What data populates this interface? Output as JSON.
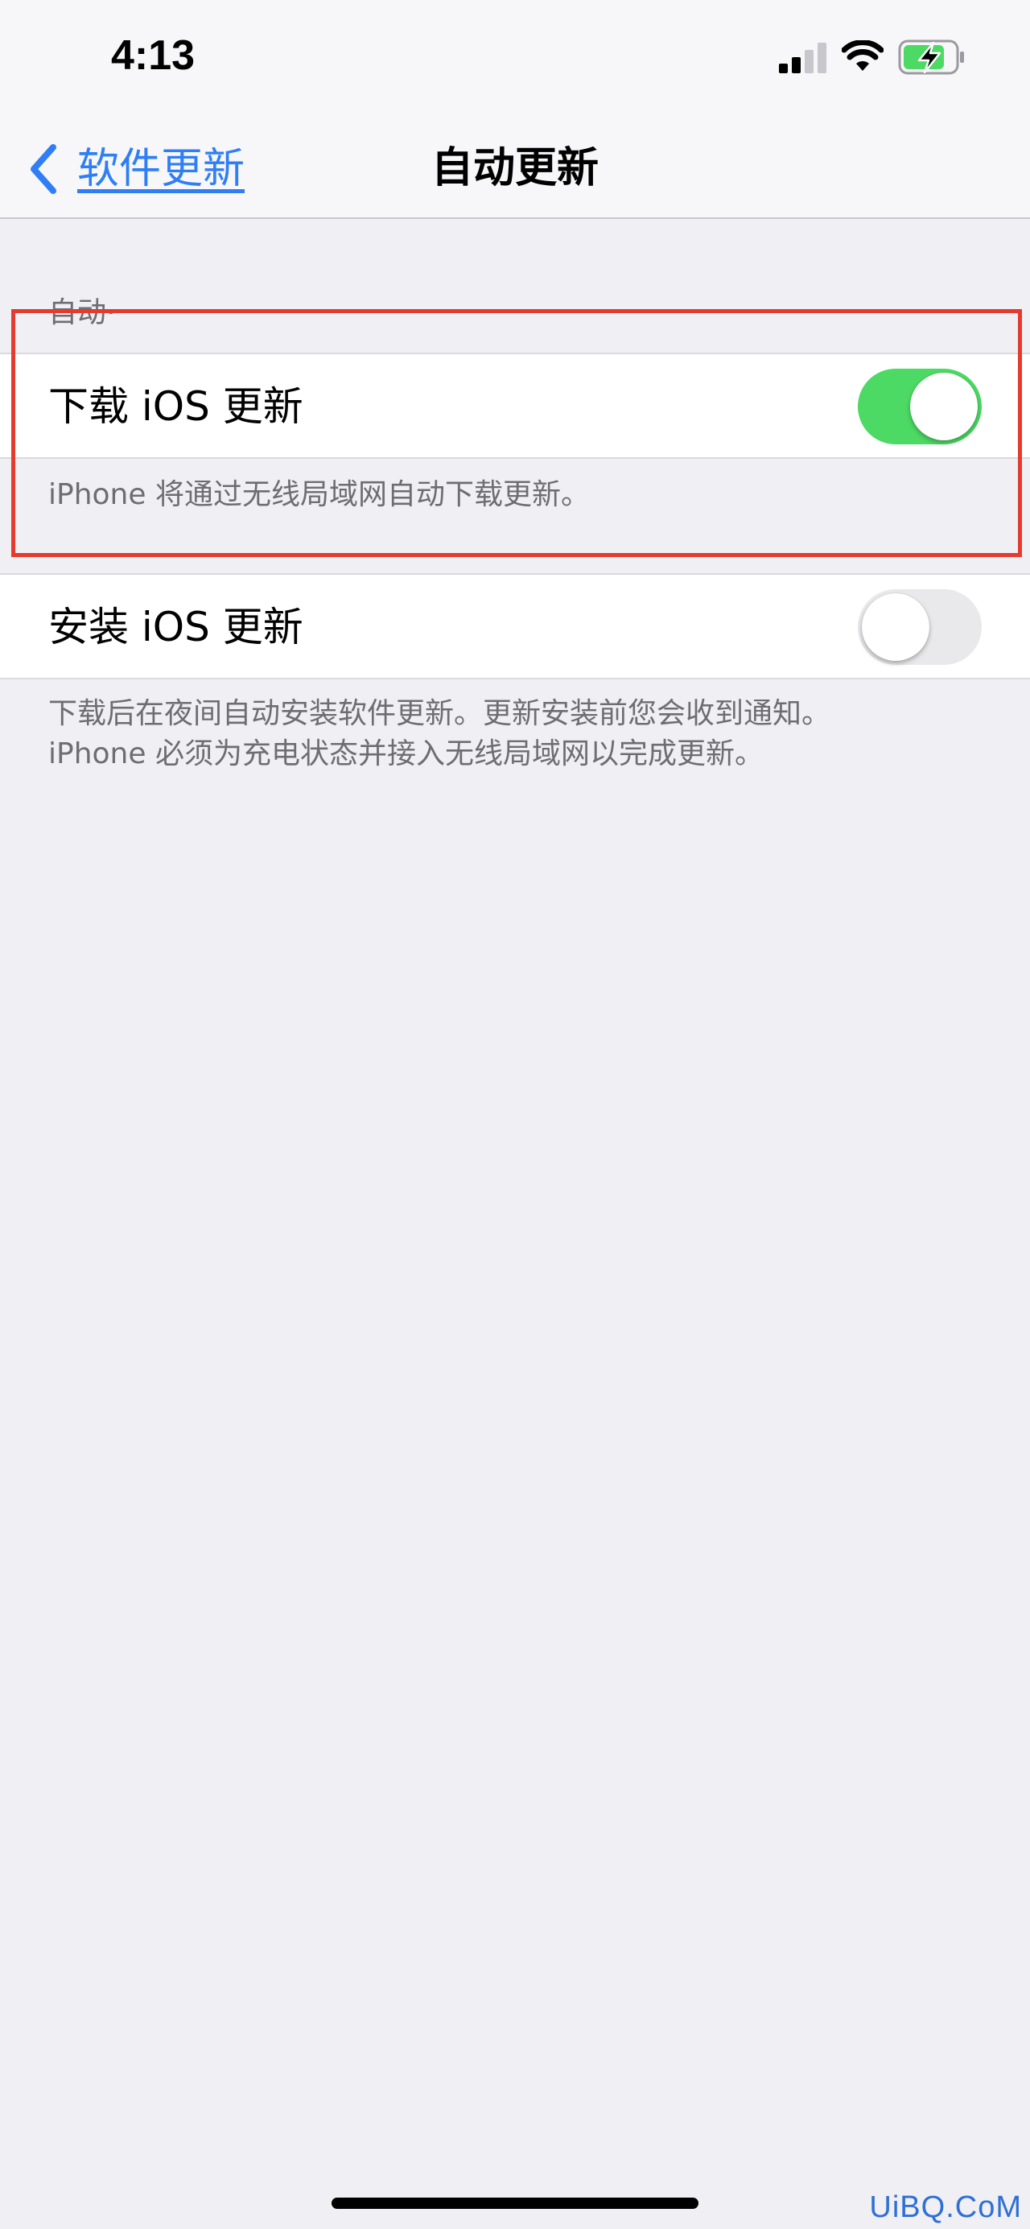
{
  "status_bar": {
    "time": "4:13"
  },
  "nav": {
    "back_label": "软件更新",
    "title": "自动更新"
  },
  "section": {
    "header": "自动·"
  },
  "rows": {
    "download": {
      "label": "下载 iOS 更新",
      "enabled": true,
      "footer": "iPhone 将通过无线局域网自动下载更新。"
    },
    "install": {
      "label": "安装 iOS 更新",
      "enabled": false,
      "footer_line1": "下载后在夜间自动安装软件更新。更新安装前您会收到通知。",
      "footer_line2": "iPhone 必须为充电状态并接入无线局域网以完成更新。"
    }
  },
  "watermark": "UiBQ.CoM",
  "colors": {
    "accent": "#2f7ef6",
    "toggle_on": "#4cd964",
    "toggle_off": "#e9e9eb",
    "highlight": "#e53a2e",
    "background": "#efeff4"
  },
  "icons": {
    "signal": "cellular-signal-icon",
    "wifi": "wifi-icon",
    "battery": "battery-charging-icon",
    "back": "chevron-left-icon"
  }
}
